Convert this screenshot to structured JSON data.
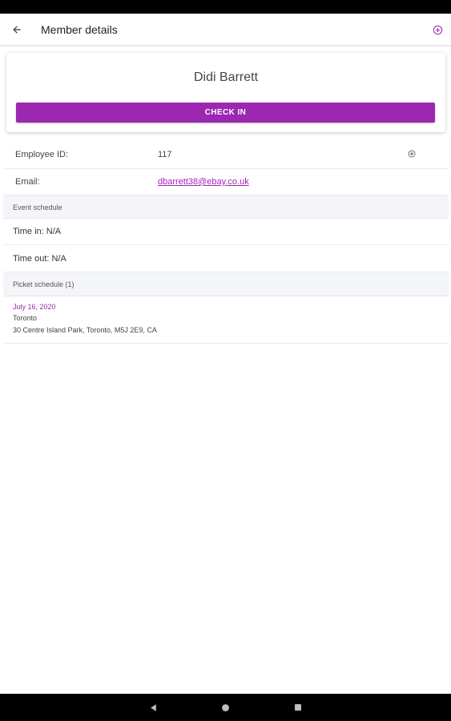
{
  "header": {
    "title": "Member details",
    "back_icon": "arrow-back-icon",
    "action_icon": "plus-circle-icon"
  },
  "member": {
    "name": "Didi Barrett",
    "check_in_label": "CHECK IN"
  },
  "details": {
    "employee_id_label": "Employee ID:",
    "employee_id_value": "117",
    "email_label": "Email:",
    "email_value": "dbarrett38@ebay.co.uk"
  },
  "event_schedule": {
    "header": "Event schedule",
    "time_in": "Time in: N/A",
    "time_out": "Time out: N/A"
  },
  "picket_schedule": {
    "header": "Picket schedule (1)",
    "items": [
      {
        "date": "July 16, 2020",
        "city": "Toronto",
        "address": "30 Centre Island Park, Toronto, M5J 2E9, CA"
      }
    ]
  },
  "colors": {
    "accent": "#9c27b0",
    "section_bg": "#f4f5f8"
  }
}
